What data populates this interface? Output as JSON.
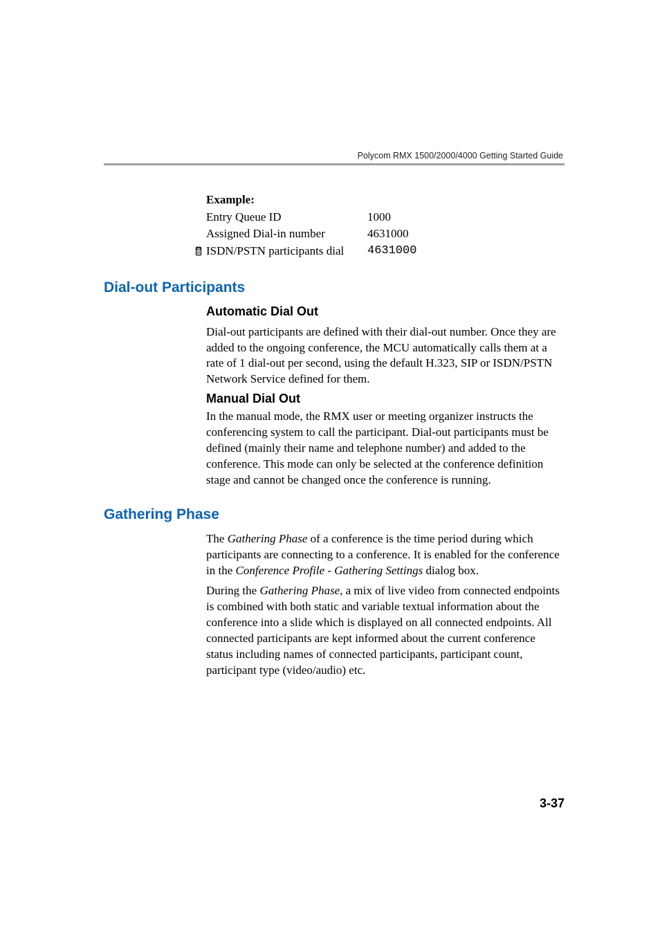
{
  "running_head": "Polycom RMX 1500/2000/4000 Getting Started Guide",
  "example": {
    "label": "Example:",
    "entry_queue_id_label": "Entry Queue ID",
    "entry_queue_id_value": "1000",
    "assigned_dial_in_label": "Assigned Dial-in number",
    "assigned_dial_in_value": "4631000",
    "isdn_pstn_label": "ISDN/PSTN participants dial",
    "isdn_pstn_value": "4631000"
  },
  "sections": {
    "dial_out": {
      "title": "Dial-out Participants",
      "auto": {
        "title": "Automatic Dial Out",
        "para": "Dial-out participants are defined with their dial-out number. Once they are added to the ongoing conference, the MCU automatically calls them at a rate of 1 dial-out per second, using the default H.323, SIP or ISDN/PSTN Network Service defined for them."
      },
      "manual": {
        "title": "Manual Dial Out",
        "para": "In the manual mode, the RMX user or meeting organizer instructs the conferencing system to call the participant. Dial-out participants must be defined (mainly their name and telephone number) and added to the conference. This mode can only be selected at the conference definition stage and cannot be changed once the conference is running."
      }
    },
    "gathering": {
      "title": "Gathering Phase",
      "para1_pre": "The ",
      "para1_em1": "Gathering Phase",
      "para1_mid": " of a conference is the time period during which participants are connecting to a conference. It is enabled for the conference in the ",
      "para1_em2": "Conference Profile - Gathering Settings",
      "para1_post": " dialog box.",
      "para2_pre": "During the ",
      "para2_em": "Gathering Phase",
      "para2_post": ", a mix of live video from connected endpoints is combined with both static and variable textual information about the conference into a slide which is displayed on all connected endpoints. All connected participants are kept informed about the current conference status including names of connected participants, participant count, participant type (video/audio) etc."
    }
  },
  "page_number": "3-37"
}
